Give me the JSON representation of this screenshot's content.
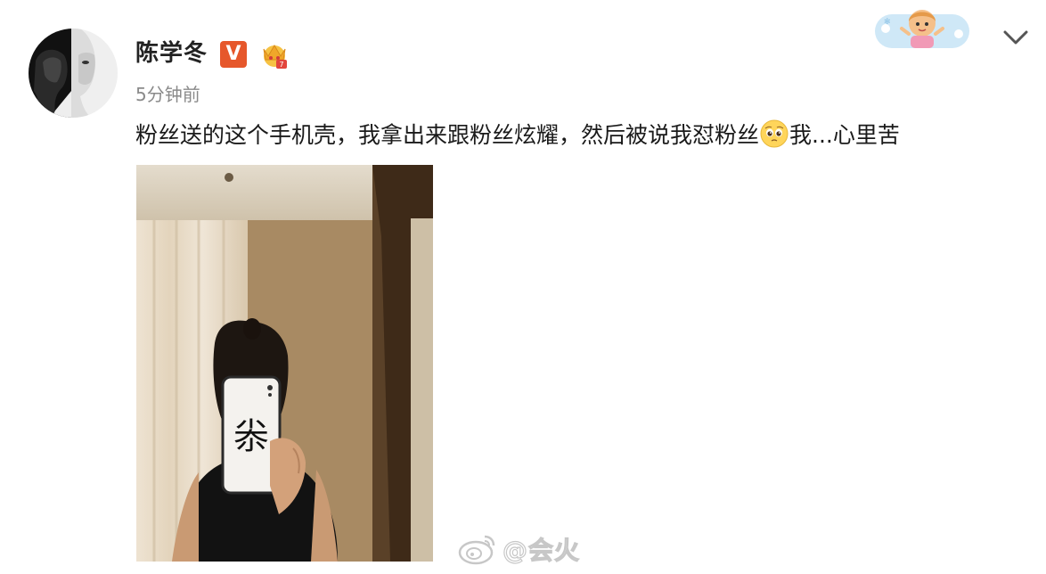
{
  "post": {
    "author": "陈学冬",
    "verified_badge": "V",
    "time": "5分钟前",
    "text_before_emoji": "粉丝送的这个手机壳，我拿出来跟粉丝炫耀，然后被说我怼粉丝",
    "emoji": "pleading-face-icon",
    "text_after_emoji": "我...心里苦",
    "phone_case_character": "尜"
  },
  "watermark": {
    "text": "@会火"
  },
  "icons": {
    "avatar": "avatar",
    "verified": "verified-v-icon",
    "crown": "vip-crown-icon",
    "menu": "chevron-down-icon",
    "weibo": "weibo-logo-icon"
  },
  "colors": {
    "verified": "#e6572b",
    "timestamp": "#8a8a8a",
    "text": "#1a1a1a"
  }
}
